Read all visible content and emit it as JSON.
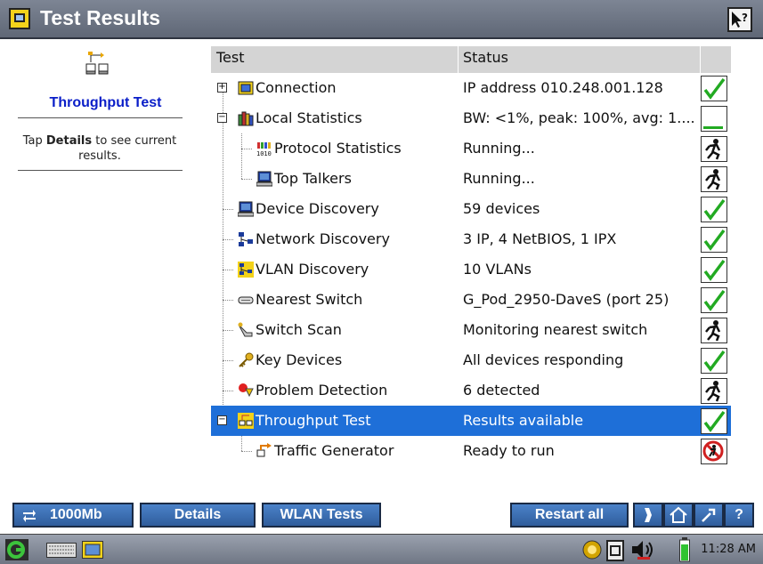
{
  "window": {
    "title": "Test Results"
  },
  "left_panel": {
    "title": "Throughput Test",
    "desc_prefix": "Tap ",
    "desc_bold": "Details",
    "desc_suffix": " to see current results."
  },
  "table": {
    "headers": {
      "test": "Test",
      "status": "Status"
    },
    "rows": [
      {
        "name": "Connection",
        "status": "IP address 010.248.001.128",
        "icon": "connection-icon",
        "state": "check"
      },
      {
        "name": "Local Statistics",
        "status": "BW: <1%, peak: 100%, avg: 1....",
        "icon": "books-icon",
        "state": "level"
      },
      {
        "name": "Protocol Statistics",
        "status": "Running...",
        "icon": "protocol-icon",
        "state": "running"
      },
      {
        "name": "Top Talkers",
        "status": "Running...",
        "icon": "computer-icon",
        "state": "running"
      },
      {
        "name": "Device Discovery",
        "status": "59 devices",
        "icon": "computer-icon",
        "state": "check"
      },
      {
        "name": "Network Discovery",
        "status": "3 IP, 4 NetBIOS, 1 IPX",
        "icon": "network-icon",
        "state": "check"
      },
      {
        "name": "VLAN Discovery",
        "status": "10 VLANs",
        "icon": "vlan-icon",
        "state": "check"
      },
      {
        "name": "Nearest Switch",
        "status": "G_Pod_2950-DaveS (port 25)",
        "icon": "switch-icon",
        "state": "check"
      },
      {
        "name": "Switch Scan",
        "status": "Monitoring nearest switch",
        "icon": "scan-icon",
        "state": "running"
      },
      {
        "name": "Key Devices",
        "status": "All devices responding",
        "icon": "key-icon",
        "state": "check"
      },
      {
        "name": "Problem Detection",
        "status": "6 detected",
        "icon": "problem-icon",
        "state": "running"
      },
      {
        "name": "Throughput Test",
        "status": "Results available",
        "icon": "throughput-icon",
        "state": "check",
        "selected": true
      },
      {
        "name": "Traffic Generator",
        "status": "Ready to run",
        "icon": "traffic-icon",
        "state": "stop"
      }
    ]
  },
  "bottom_buttons": {
    "speed": "1000Mb",
    "details": "Details",
    "wlan": "WLAN Tests",
    "restart": "Restart all",
    "help": "?"
  },
  "taskbar": {
    "time": "11:28 AM"
  },
  "colors": {
    "titlebar": "#6b7382",
    "selection": "#1e6fd8",
    "button": "#3a6db2",
    "check": "#22aa22",
    "left_title": "#0a1ec8"
  }
}
